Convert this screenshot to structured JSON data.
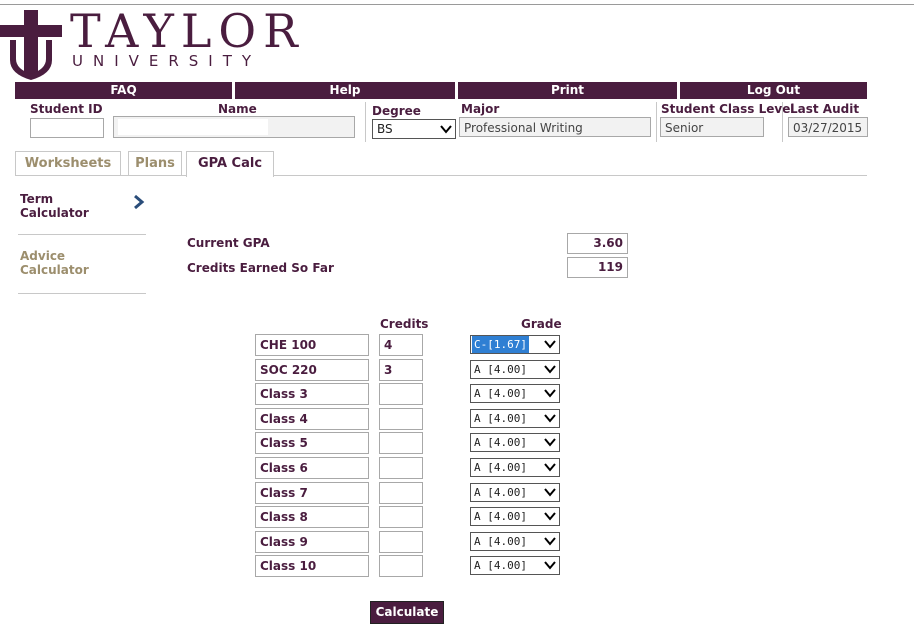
{
  "logo": {
    "title": "TAYLOR",
    "subtitle": "UNIVERSITY",
    "icon": "cross-shield-icon"
  },
  "nav": [
    {
      "label": "FAQ"
    },
    {
      "label": "Help"
    },
    {
      "label": "Print"
    },
    {
      "label": "Log Out"
    }
  ],
  "student": {
    "id_label": "Student ID",
    "id_value": "",
    "name_label": "Name",
    "name_value": "",
    "degree_label": "Degree",
    "degree_value": "BS",
    "major_label": "Major",
    "major_value": "Professional Writing",
    "class_level_label": "Student Class Level",
    "class_level_value": "Senior",
    "last_audit_label": "Last Audit",
    "last_audit_value": "03/27/2015"
  },
  "tabs": [
    {
      "label": "Worksheets",
      "active": false
    },
    {
      "label": "Plans",
      "active": false
    },
    {
      "label": "GPA Calc",
      "active": true
    }
  ],
  "side_menu": [
    {
      "label_line1": "Term",
      "label_line2": "Calculator",
      "active": true
    },
    {
      "label_line1": "Advice",
      "label_line2": "Calculator",
      "active": false
    }
  ],
  "summary": {
    "current_gpa_label": "Current GPA",
    "current_gpa_value": "3.60",
    "credits_label": "Credits Earned So Far",
    "credits_value": "119"
  },
  "table": {
    "credits_header": "Credits",
    "grade_header": "Grade",
    "rows": [
      {
        "class": "CHE 100",
        "credits": "4",
        "grade": "C-[1.67]",
        "selected": true
      },
      {
        "class": "SOC 220",
        "credits": "3",
        "grade": "A [4.00]"
      },
      {
        "class": "Class 3",
        "credits": "",
        "grade": "A [4.00]"
      },
      {
        "class": "Class 4",
        "credits": "",
        "grade": "A [4.00]"
      },
      {
        "class": "Class 5",
        "credits": "",
        "grade": "A [4.00]"
      },
      {
        "class": "Class 6",
        "credits": "",
        "grade": "A [4.00]"
      },
      {
        "class": "Class 7",
        "credits": "",
        "grade": "A [4.00]"
      },
      {
        "class": "Class 8",
        "credits": "",
        "grade": "A [4.00]"
      },
      {
        "class": "Class 9",
        "credits": "",
        "grade": "A [4.00]"
      },
      {
        "class": "Class 10",
        "credits": "",
        "grade": "A [4.00]"
      }
    ]
  },
  "calculate_label": "Calculate",
  "colors": {
    "brand": "#4a1d3f",
    "tab_inactive": "#9c8e6d",
    "select_highlight": "#2f7fd3"
  }
}
